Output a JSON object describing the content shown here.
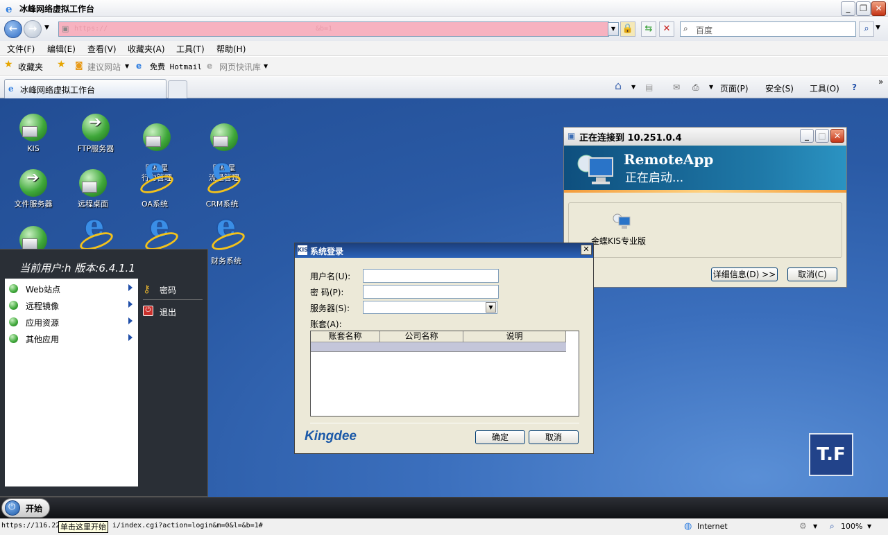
{
  "window": {
    "title": "冰峰网络虚拟工作台"
  },
  "address": {
    "url_prefix": "https://",
    "url_suffix": "&b=1",
    "search_placeholder": "百度"
  },
  "menu": [
    "文件(F)",
    "编辑(E)",
    "查看(V)",
    "收藏夹(A)",
    "工具(T)",
    "帮助(H)"
  ],
  "favorites": {
    "label": "收藏夹",
    "items": [
      "建议网站",
      "免费 Hotmail",
      "网页快讯库"
    ]
  },
  "tab": {
    "title": "冰峰网络虚拟工作台"
  },
  "commands": [
    "页面(P)",
    "安全(S)",
    "工具(O)"
  ],
  "desktop_icons": [
    "KIS",
    "FTP服务器",
    "网极星\n行为管理",
    "网极星\n流量管理",
    "文件服务器",
    "远程桌面",
    "OA系统",
    "CRM系统",
    "财务系统"
  ],
  "start_panel": {
    "header": "当前用户:h   版本:6.4.1.1",
    "left_items": [
      "Web站点",
      "远程镜像",
      "应用资源",
      "其他应用"
    ],
    "right_items": [
      "密码",
      "退出"
    ]
  },
  "taskbar": {
    "start_label": "开始"
  },
  "remote_window": {
    "title": "正在连接到 10.251.0.4",
    "brand": "RemoteApp",
    "status": "正在启动...",
    "app_name": "金蝶KIS专业版",
    "details_button": "详细信息(D) >>",
    "cancel_button": "取消(C)"
  },
  "login_dialog": {
    "title": "系统登录",
    "username_label": "用户名(U):",
    "password_label": "密  码(P):",
    "server_label": "服务器(S):",
    "account_label": "账套(A):",
    "columns": [
      "账套名称",
      "公司名称",
      "说明"
    ],
    "brand": "Kingdee",
    "ok_button": "确定",
    "cancel_button": "取消"
  },
  "status_bar": {
    "url": "https://116.22",
    "url_tail": "i/index.cgi?action=login&m=0&l=&b=1#",
    "tooltip": "单击这里开始",
    "zone": "Internet",
    "zoom": "100%"
  },
  "colors": {
    "desktop": "#2a5aa5",
    "accent": "#1f4ea8",
    "address_bar": "#f7b2c0"
  }
}
